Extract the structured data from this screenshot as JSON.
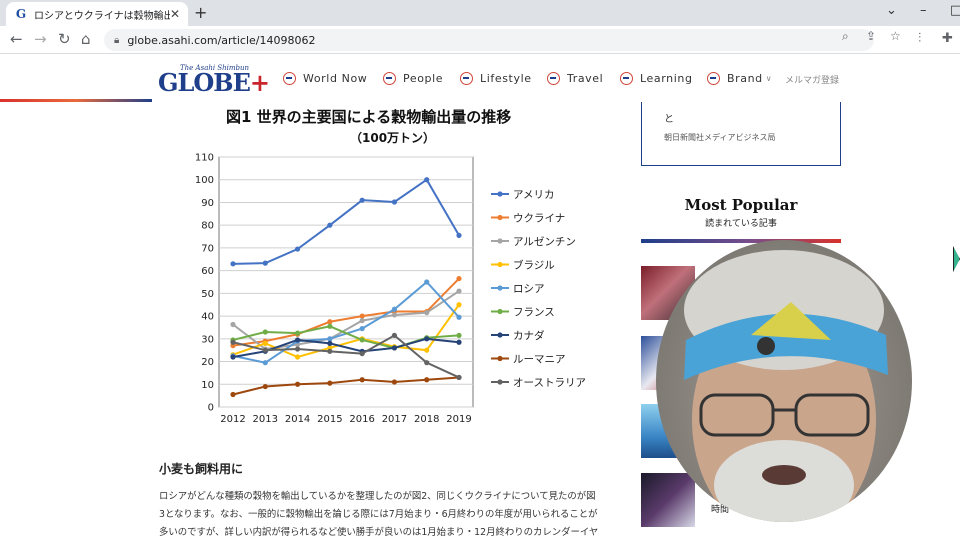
{
  "browser": {
    "tab_title": "ロシアとウクライナは穀物輸出の好敵",
    "tab_favicon": "G",
    "new_tab": "+",
    "url": "globe.asahi.com/article/14098062"
  },
  "site": {
    "logo_sub": "The Asahi Shimbun",
    "logo_main": "GLOBE",
    "logo_plus": "+",
    "nav": [
      "World Now",
      "People",
      "Lifestyle",
      "Travel",
      "Learning",
      "Brand"
    ],
    "brand_caret": "∨",
    "mailmag": "メルマガ登録",
    "brand_colors": {
      "navy": "#1f3f8a",
      "red": "#d8322c"
    }
  },
  "figure": {
    "title": "図1  世界の主要国による穀物輸出量の推移",
    "unit": "（100万トン）"
  },
  "chart_data": {
    "type": "line",
    "title": "図1  世界の主要国による穀物輸出量の推移",
    "ylabel": "（100万トン）",
    "xlabel": "",
    "categories": [
      "2012",
      "2013",
      "2014",
      "2015",
      "2016",
      "2017",
      "2018",
      "2019"
    ],
    "yticks": [
      0,
      10,
      20,
      30,
      40,
      50,
      60,
      70,
      80,
      90,
      100,
      110
    ],
    "ylim": [
      0,
      110
    ],
    "grid": true,
    "legend": "right",
    "series": [
      {
        "name": "アメリカ",
        "color": "#4472c4",
        "values": [
          63,
          63.3,
          69.5,
          80,
          91,
          90.2,
          100,
          75.5
        ]
      },
      {
        "name": "ウクライナ",
        "color": "#ed7d31",
        "values": [
          27,
          29,
          32,
          37.5,
          40,
          42,
          42,
          56.5
        ]
      },
      {
        "name": "アルゼンチン",
        "color": "#a5a5a5",
        "values": [
          36.3,
          25.5,
          27.5,
          30,
          38,
          40.5,
          41.5,
          51
        ]
      },
      {
        "name": "ブラジル",
        "color": "#ffc000",
        "values": [
          23,
          28,
          22,
          26,
          30,
          26.5,
          25,
          45
        ]
      },
      {
        "name": "ロシア",
        "color": "#5b9bd5",
        "values": [
          22.5,
          19.5,
          29,
          30,
          34.5,
          43,
          55,
          39.5
        ]
      },
      {
        "name": "フランス",
        "color": "#70ad47",
        "values": [
          29.5,
          33,
          32.5,
          35.5,
          29.5,
          26,
          30.5,
          31.5
        ]
      },
      {
        "name": "カナダ",
        "color": "#264478",
        "values": [
          22,
          24.5,
          29.5,
          28,
          24.5,
          26,
          30,
          28.5
        ]
      },
      {
        "name": "ルーマニア",
        "color": "#9e480e",
        "values": [
          5.5,
          9,
          10,
          10.5,
          12,
          11,
          12,
          13
        ]
      },
      {
        "name": "オーストラリア",
        "color": "#636363",
        "values": [
          28.5,
          25,
          25.5,
          24.5,
          23.5,
          31.5,
          19.5,
          13
        ]
      }
    ]
  },
  "article": {
    "section_heading": "小麦も飼料用に",
    "lines": [
      "ロシアがどんな種類の穀物を輸出しているかを整理したのが図2、同じくウクライナについて見たのが図",
      "3となります。なお、一般的に穀物輸出を論じる際には7月始まり・6月終わりの年度が用いられることが",
      "多いのですが、詳しい内訳が得られるなど使い勝手が良いのは1月始まり・12月終わりのカレンダーイヤ"
    ]
  },
  "sidebar": {
    "box_text": "と",
    "box_org": "朝日新聞社メディアビジネス局",
    "popular_title": "Most Popular",
    "popular_sub": "読まれている記事",
    "thumb_caption": "時間"
  }
}
